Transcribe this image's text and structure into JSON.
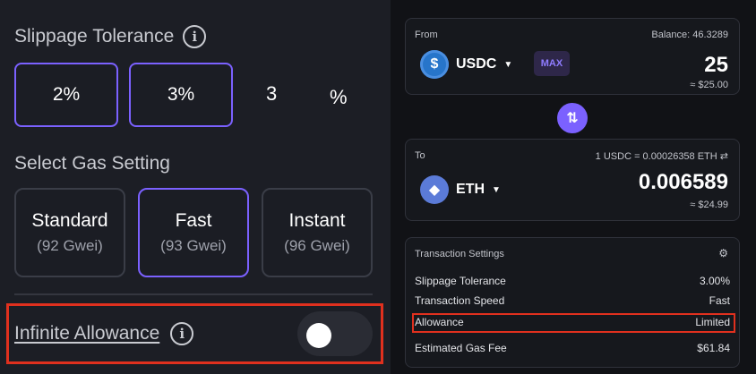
{
  "left": {
    "slippage": {
      "title": "Slippage Tolerance",
      "options": [
        "2%",
        "3%"
      ],
      "custom_value": "3",
      "custom_suffix": "%"
    },
    "gas": {
      "title": "Select Gas Setting",
      "options": [
        {
          "name": "Standard",
          "price": "(92 Gwei)"
        },
        {
          "name": "Fast",
          "price": "(93 Gwei)"
        },
        {
          "name": "Instant",
          "price": "(96 Gwei)"
        }
      ],
      "selected": "Fast"
    },
    "allowance": {
      "label": "Infinite Allowance",
      "enabled": false
    },
    "info_glyph": "i"
  },
  "right": {
    "from": {
      "label": "From",
      "balance": "Balance: 46.3289",
      "token": "USDC",
      "max_label": "MAX",
      "amount": "25",
      "usd_value": "≈ $25.00"
    },
    "swap_icon": "⇅",
    "to": {
      "label": "To",
      "rate": "1 USDC = 0.00026358 ETH ⇄",
      "token": "ETH",
      "amount": "0.006589",
      "usd_value": "≈ $24.99"
    },
    "settings": {
      "title": "Transaction Settings",
      "rows": [
        {
          "label": "Slippage Tolerance",
          "value": "3.00%"
        },
        {
          "label": "Transaction Speed",
          "value": "Fast"
        },
        {
          "label": "Allowance",
          "value": "Limited"
        },
        {
          "label": "Estimated Gas Fee",
          "value": "$61.84"
        }
      ]
    }
  },
  "colors": {
    "accent": "#7b61ff",
    "highlight": "#e0301e",
    "usdc": "#2775ca",
    "eth": "#5b7bd8"
  },
  "icons": [
    "info-icon",
    "usdc-token-icon",
    "eth-token-icon",
    "swap-direction-icon",
    "gear-icon",
    "chevron-down-icon"
  ]
}
